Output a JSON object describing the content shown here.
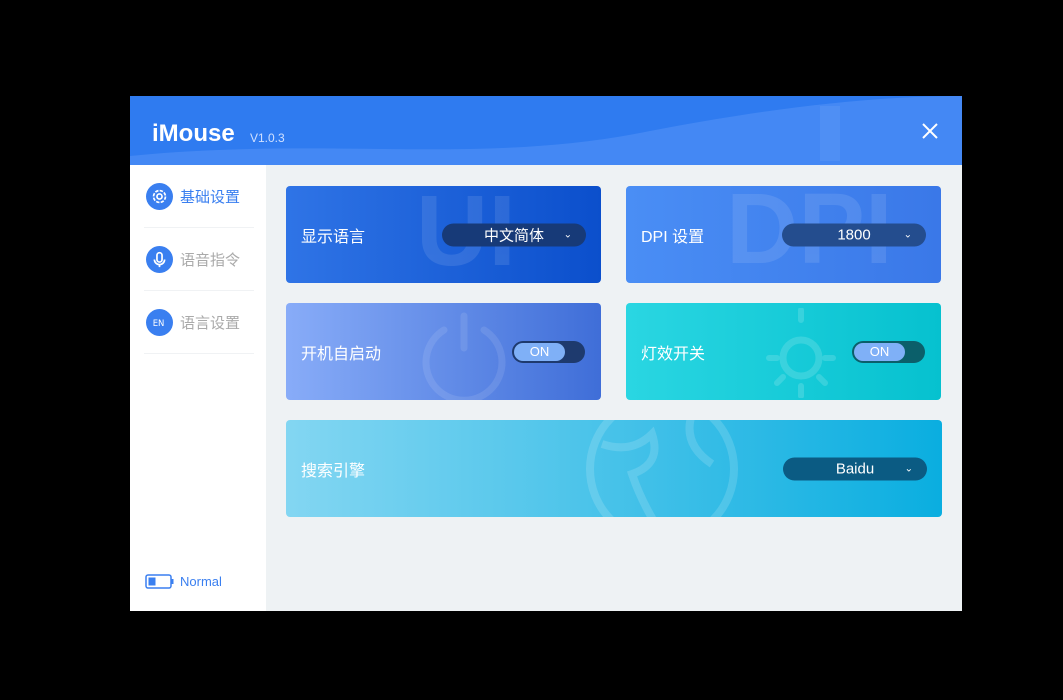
{
  "app": {
    "title": "iMouse",
    "version": "V1.0.3"
  },
  "sidebar": {
    "items": [
      {
        "label": "基础设置",
        "active": true
      },
      {
        "label": "语音指令",
        "active": false
      },
      {
        "label": "语言设置",
        "active": false
      }
    ],
    "status": "Normal"
  },
  "cards": {
    "language": {
      "label": "显示语言",
      "value": "中文简体",
      "bg_text": "UI"
    },
    "dpi": {
      "label": "DPI 设置",
      "value": "1800",
      "bg_text": "DPI"
    },
    "autostart": {
      "label": "开机自启动",
      "state": "ON"
    },
    "lighting": {
      "label": "灯效开关",
      "state": "ON"
    },
    "search": {
      "label": "搜索引擎",
      "value": "Baidu"
    }
  },
  "colors": {
    "accent": "#3a7ff0",
    "header": "#2f7bf0"
  }
}
